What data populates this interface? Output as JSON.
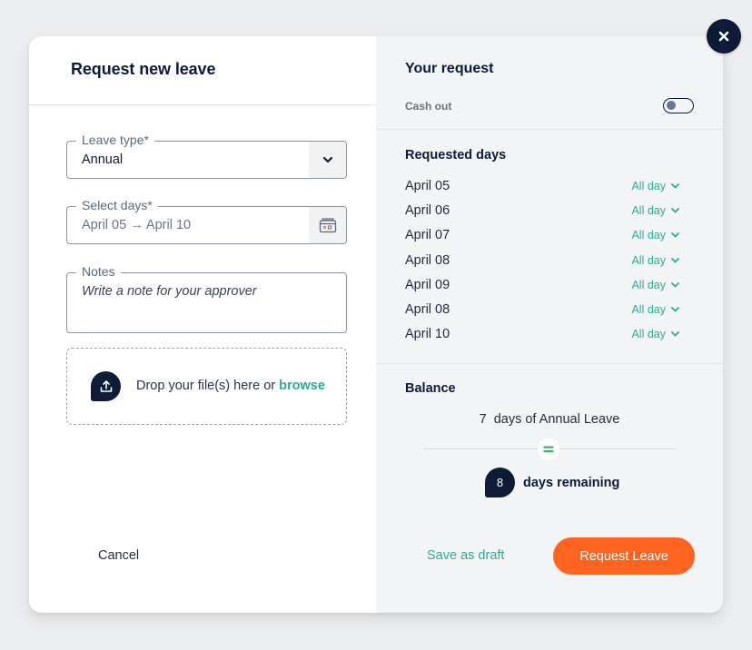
{
  "left": {
    "title": "Request new leave",
    "leave_type": {
      "label": "Leave type*",
      "value": "Annual"
    },
    "select_days": {
      "label": "Select days*",
      "value": "April 05 → April 10"
    },
    "notes": {
      "label": "Notes",
      "placeholder": "Write a note for your approver"
    },
    "dropzone": {
      "text": "Drop your file(s) here or ",
      "link": "browse"
    },
    "cancel_label": "Cancel"
  },
  "right": {
    "title": "Your request",
    "cash_out": {
      "label": "Cash out",
      "enabled": false
    },
    "requested_days": {
      "title": "Requested days",
      "items": [
        {
          "date": "April 05",
          "duration": "All day"
        },
        {
          "date": "April 06",
          "duration": "All day"
        },
        {
          "date": "April 07",
          "duration": "All day"
        },
        {
          "date": "April 08",
          "duration": "All day"
        },
        {
          "date": "April 09",
          "duration": "All day"
        },
        {
          "date": "April 08",
          "duration": "All day"
        },
        {
          "date": "April 10",
          "duration": "All day"
        }
      ]
    },
    "balance": {
      "title": "Balance",
      "days": "7",
      "days_text": "days of Annual Leave",
      "remaining": "8",
      "remaining_text": "days remaining"
    },
    "save_draft_label": "Save as draft",
    "request_label": "Request Leave"
  },
  "colors": {
    "navy": "#0d1b36",
    "teal": "#2bab99",
    "orange": "#ff6320",
    "equals_green": "#3cb371"
  }
}
